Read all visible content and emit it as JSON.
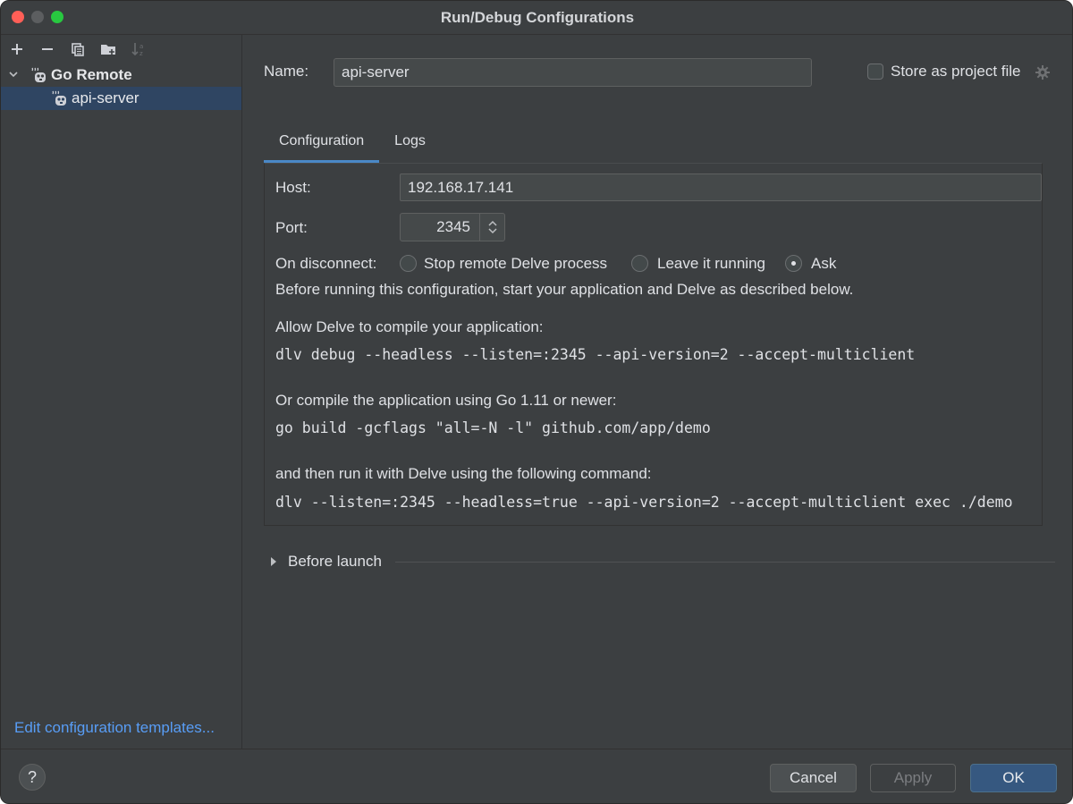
{
  "window": {
    "title": "Run/Debug Configurations"
  },
  "toolbar": {
    "add_icon": "plus-icon",
    "remove_icon": "minus-icon",
    "copy_icon": "copy-icon",
    "folder_icon": "new-folder-icon",
    "sort_icon": "sort-alpha-icon"
  },
  "tree": {
    "group_label": "Go Remote",
    "items": [
      {
        "label": "api-server"
      }
    ]
  },
  "left_footer": {
    "edit_templates": "Edit configuration templates..."
  },
  "form": {
    "name_label": "Name:",
    "name_value": "api-server",
    "store_label": "Store as project file"
  },
  "tabs": [
    {
      "label": "Configuration"
    },
    {
      "label": "Logs"
    }
  ],
  "config": {
    "host_label": "Host:",
    "host_value": "192.168.17.141",
    "port_label": "Port:",
    "port_value": "2345",
    "disconnect_label": "On disconnect:",
    "radio_stop": "Stop remote Delve process",
    "radio_leave": "Leave it running",
    "radio_ask": "Ask",
    "selected_option": "Ask",
    "intro": "Before running this configuration, start your application and Delve as described below.",
    "allow_text": "Allow Delve to compile your application:",
    "cmd1": "dlv debug --headless --listen=:2345 --api-version=2 --accept-multiclient",
    "compile_text": "Or compile the application using Go 1.11 or newer:",
    "cmd2": "go build -gcflags \"all=-N -l\" github.com/app/demo",
    "then_text": "and then run it with Delve using the following command:",
    "cmd3": "dlv --listen=:2345 --headless=true --api-version=2 --accept-multiclient exec ./demo"
  },
  "before_launch": {
    "label": "Before launch"
  },
  "buttons": {
    "help": "?",
    "cancel": "Cancel",
    "apply": "Apply",
    "ok": "OK"
  },
  "colors": {
    "accent": "#4a88c7",
    "link": "#589df6",
    "selection": "#2f4562",
    "ok_button": "#365880"
  }
}
